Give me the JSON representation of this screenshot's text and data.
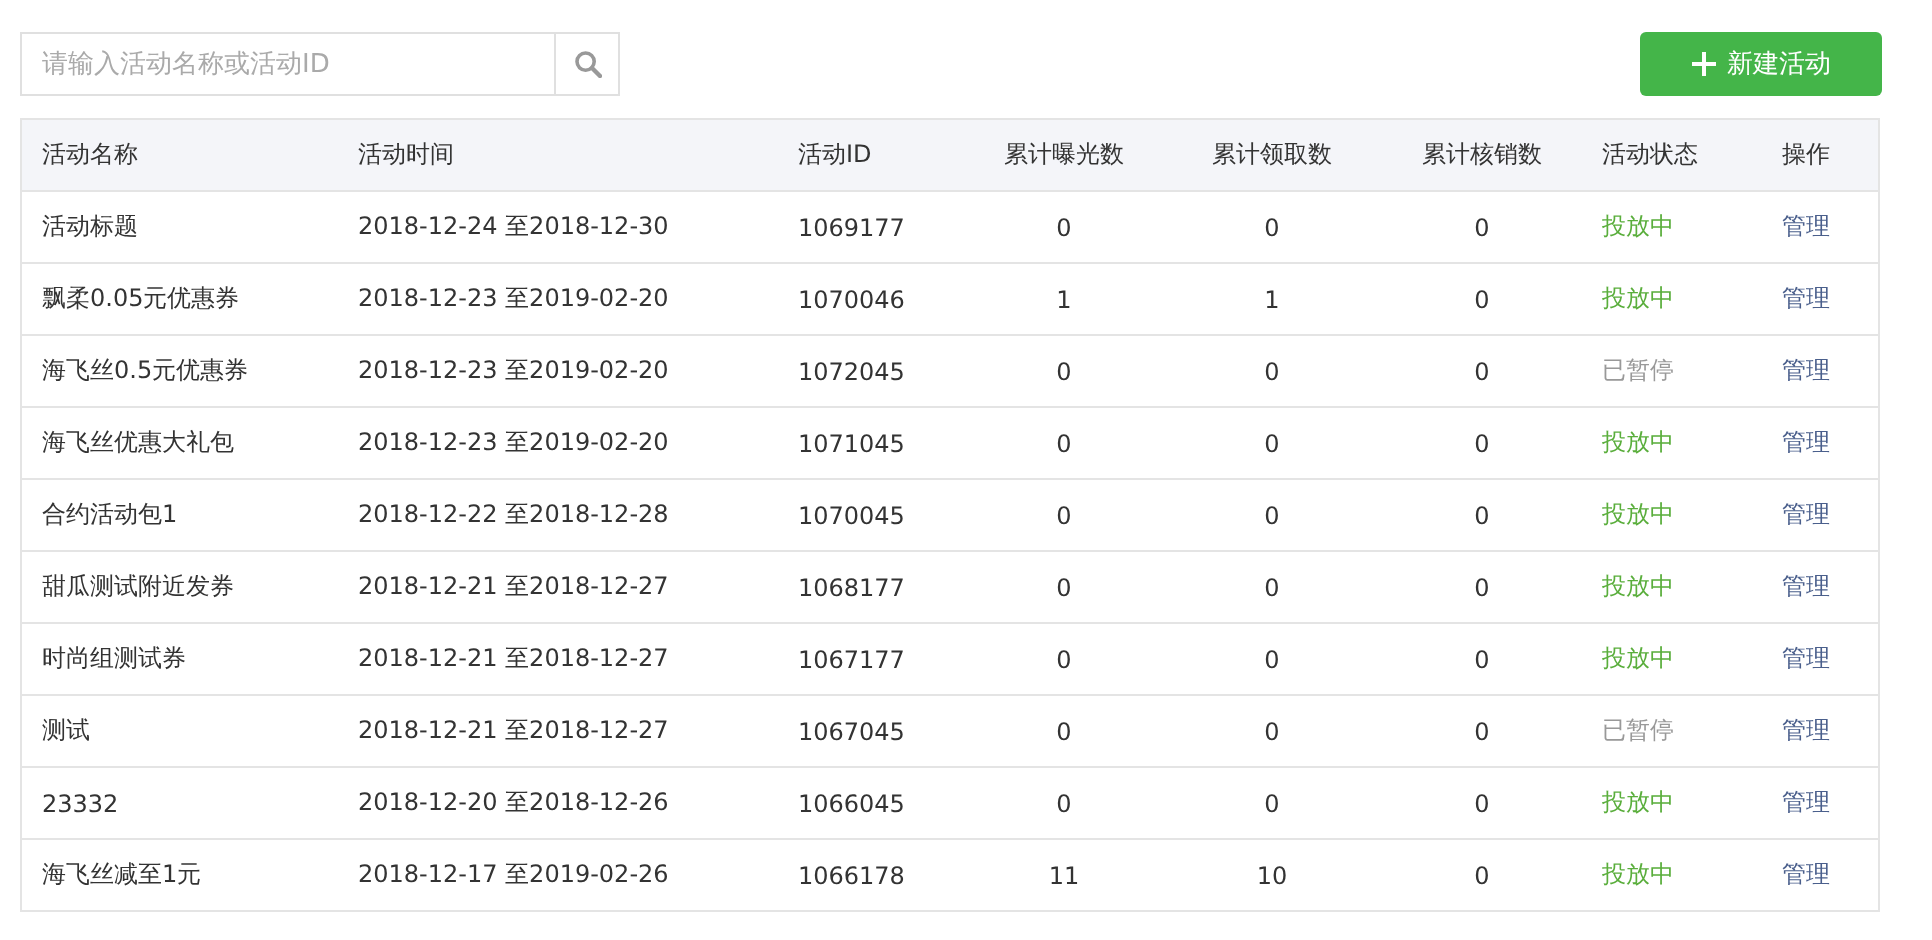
{
  "search": {
    "placeholder": "请输入活动名称或活动ID"
  },
  "new_button": {
    "label": "新建活动"
  },
  "table": {
    "columns": [
      "活动名称",
      "活动时间",
      "活动ID",
      "累计曝光数",
      "累计领取数",
      "累计核销数",
      "活动状态",
      "操作"
    ],
    "rows": [
      {
        "name": "活动标题",
        "time": "2018-12-24 至2018-12-30",
        "id": "1069177",
        "exposures": "0",
        "claims": "0",
        "redemptions": "0",
        "status": {
          "text": "投放中",
          "kind": "active"
        },
        "action": "管理"
      },
      {
        "name": "飘柔0.05元优惠券",
        "time": "2018-12-23 至2019-02-20",
        "id": "1070046",
        "exposures": "1",
        "claims": "1",
        "redemptions": "0",
        "status": {
          "text": "投放中",
          "kind": "active"
        },
        "action": "管理"
      },
      {
        "name": "海飞丝0.5元优惠券",
        "time": "2018-12-23 至2019-02-20",
        "id": "1072045",
        "exposures": "0",
        "claims": "0",
        "redemptions": "0",
        "status": {
          "text": "已暂停",
          "kind": "paused"
        },
        "action": "管理"
      },
      {
        "name": "海飞丝优惠大礼包",
        "time": "2018-12-23 至2019-02-20",
        "id": "1071045",
        "exposures": "0",
        "claims": "0",
        "redemptions": "0",
        "status": {
          "text": "投放中",
          "kind": "active"
        },
        "action": "管理"
      },
      {
        "name": "合约活动包1",
        "time": "2018-12-22 至2018-12-28",
        "id": "1070045",
        "exposures": "0",
        "claims": "0",
        "redemptions": "0",
        "status": {
          "text": "投放中",
          "kind": "active"
        },
        "action": "管理"
      },
      {
        "name": "甜瓜测试附近发券",
        "time": "2018-12-21 至2018-12-27",
        "id": "1068177",
        "exposures": "0",
        "claims": "0",
        "redemptions": "0",
        "status": {
          "text": "投放中",
          "kind": "active"
        },
        "action": "管理"
      },
      {
        "name": "时尚组测试券",
        "time": "2018-12-21 至2018-12-27",
        "id": "1067177",
        "exposures": "0",
        "claims": "0",
        "redemptions": "0",
        "status": {
          "text": "投放中",
          "kind": "active"
        },
        "action": "管理"
      },
      {
        "name": "测试",
        "time": "2018-12-21 至2018-12-27",
        "id": "1067045",
        "exposures": "0",
        "claims": "0",
        "redemptions": "0",
        "status": {
          "text": "已暂停",
          "kind": "paused"
        },
        "action": "管理"
      },
      {
        "name": "23332",
        "time": "2018-12-20 至2018-12-26",
        "id": "1066045",
        "exposures": "0",
        "claims": "0",
        "redemptions": "0",
        "status": {
          "text": "投放中",
          "kind": "active"
        },
        "action": "管理"
      },
      {
        "name": "海飞丝减至1元",
        "time": "2018-12-17 至2019-02-26",
        "id": "1066178",
        "exposures": "11",
        "claims": "10",
        "redemptions": "0",
        "status": {
          "text": "投放中",
          "kind": "active"
        },
        "action": "管理"
      }
    ]
  }
}
